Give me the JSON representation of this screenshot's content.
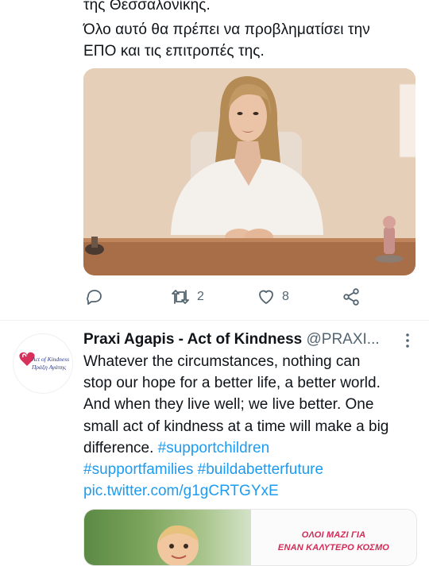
{
  "previous_tweet": {
    "text_lines": [
      "της Θεσσαλονίκης.",
      "Όλο αυτό θα πρέπει να προβληματίσει την",
      "ΕΠΟ και τις επιτροπές της."
    ],
    "actions": {
      "reply_count": "",
      "retweet_count": "2",
      "like_count": "8"
    }
  },
  "tweet": {
    "author_name": "Praxi Agapis - Act of Kindness",
    "author_handle": "@PRAXI...",
    "avatar": {
      "logo_line1": "Act of Kindness",
      "logo_line2": "Πράξη Αγάπης"
    },
    "text_lines": [
      "Whatever the circumstances, nothing can",
      "stop  our hope for a better life, a better world.",
      "And when they live well; we live better. One",
      "small act of kindness at a time will make a big"
    ],
    "last_line_text": "difference. ",
    "hashtag1": "#supportchildren",
    "hashtag2": "#supportfamilies",
    "hashtag3": "#buildabetterfuture",
    "link": "pic.twitter.com/g1gCRTGYxE",
    "card": {
      "caption_line1": "ΟΛΟΙ ΜΑΖΙ ΓΙΑ",
      "caption_line2": "ΕΝΑΝ ΚΑΛΥΤΕΡΟ ΚΟΣΜΟ"
    }
  },
  "colors": {
    "accent": "#1d9bf0",
    "muted": "#536471",
    "heart_logo": "#d8315b"
  }
}
